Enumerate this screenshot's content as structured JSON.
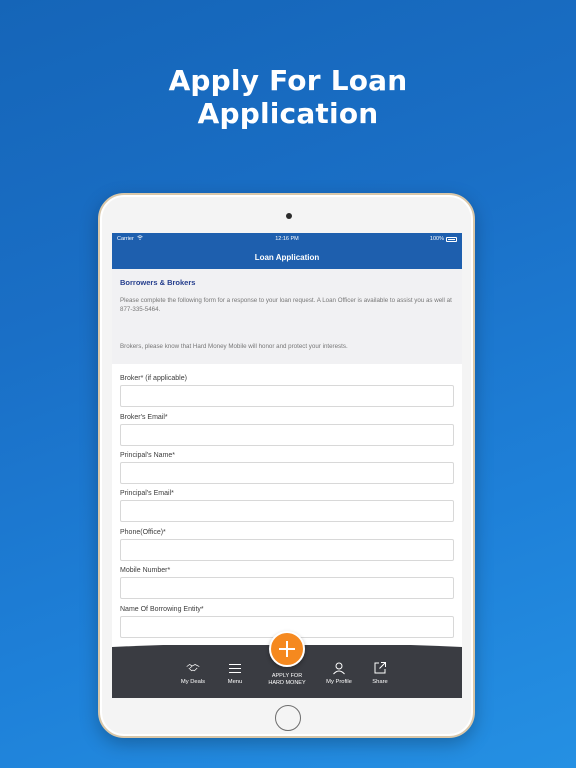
{
  "headline": {
    "line1": "Apply For Loan",
    "line2": "Application"
  },
  "status_bar": {
    "carrier": "Carrier",
    "time": "12:16 PM",
    "battery": "100%"
  },
  "nav": {
    "title": "Loan Application"
  },
  "intro": {
    "heading": "Borrowers & Brokers",
    "text": "Please complete the following form for a response to your loan request. A Loan Officer is available to assist you as well at 877-335-5464.",
    "brokers_note": "Brokers, please know that Hard Money Mobile will honor and protect your interests."
  },
  "form": {
    "fields": [
      {
        "label": "Broker* (if applicable)",
        "value": ""
      },
      {
        "label": "Broker's Email*",
        "value": ""
      },
      {
        "label": "Principal's Name*",
        "value": ""
      },
      {
        "label": "Principal's Email*",
        "value": ""
      },
      {
        "label": "Phone(Office)*",
        "value": ""
      },
      {
        "label": "Mobile Number*",
        "value": ""
      },
      {
        "label": "Name Of Borrowing Entity*",
        "value": ""
      }
    ]
  },
  "tabbar": {
    "items": [
      {
        "label": "My Deals",
        "icon": "handshake-icon"
      },
      {
        "label": "Menu",
        "icon": "menu-icon"
      },
      {
        "label": "My Profile",
        "icon": "user-icon"
      },
      {
        "label": "Share",
        "icon": "share-icon"
      }
    ],
    "apply_label_line1": "APPLY FOR",
    "apply_label_line2": "HARD MONEY",
    "apply_icon": "plus-icon"
  },
  "colors": {
    "background": "#1a6fc6",
    "nav_bar": "#1e5fae",
    "heading_text": "#253e8d",
    "tab_bar": "#3a3c42",
    "fab": "#f5891f"
  }
}
